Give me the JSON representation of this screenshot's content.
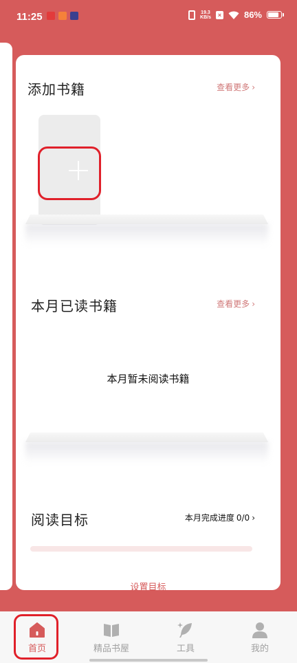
{
  "status_bar": {
    "time": "11:25",
    "net_speed_value": "19.3",
    "net_speed_unit": "KB/s",
    "battery": "86%",
    "battery_level": 0.86
  },
  "colors": {
    "accent": "#d65b5b",
    "highlight": "#e0202a"
  },
  "add_books": {
    "title": "添加书籍",
    "see_more": "查看更多",
    "add_icon": "plus-icon"
  },
  "monthly_read": {
    "title": "本月已读书籍",
    "see_more": "查看更多",
    "empty_text": "本月暂未阅读书籍"
  },
  "reading_goal": {
    "title": "阅读目标",
    "progress_label": "本月完成进度",
    "progress_value": "0/0",
    "progress_fraction": 0,
    "set_goal": "设置目标"
  },
  "bottom_nav": {
    "items": [
      {
        "label": "首页",
        "icon": "home-icon",
        "active": true
      },
      {
        "label": "精品书屋",
        "icon": "book-icon",
        "active": false
      },
      {
        "label": "工具",
        "icon": "feather-icon",
        "active": false
      },
      {
        "label": "我的",
        "icon": "user-icon",
        "active": false
      }
    ]
  }
}
